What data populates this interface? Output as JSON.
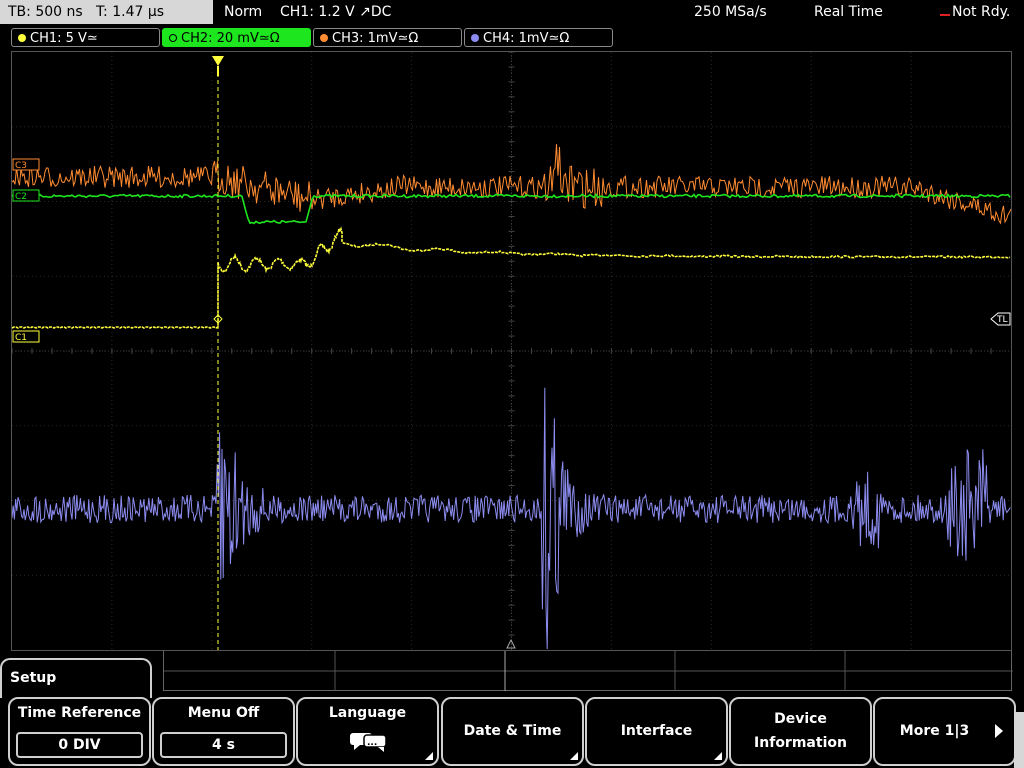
{
  "topbar": {
    "timebase": "TB: 500 ns",
    "trigger_time": "T: 1.47 µs",
    "trigger_mode": "Norm",
    "trigger_source": "CH1: 1.2 V ↗DC",
    "sample_rate": "250 MSa/s",
    "acq_mode": "Real Time",
    "status": "Not Rdy."
  },
  "channels": [
    {
      "label": "CH1: 5 V≃",
      "color": "#ffff3c"
    },
    {
      "label": "CH2: 20 mV≃Ω",
      "color": "#1ee61e"
    },
    {
      "label": "CH3: 1mV≃Ω",
      "color": "#ff8c32"
    },
    {
      "label": "CH4: 1mV≃Ω",
      "color": "#8c8cf0"
    }
  ],
  "markers": {
    "c3": "C3",
    "c2": "C2",
    "c1": "C1",
    "trigger_level": "TL"
  },
  "menu": {
    "title": "Setup",
    "time_reference": {
      "label": "Time Reference",
      "value": "0 DIV"
    },
    "menu_off": {
      "label": "Menu Off",
      "value": "4 s"
    },
    "language": {
      "label": "Language"
    },
    "date_time": {
      "label": "Date & Time"
    },
    "interface": {
      "label": "Interface"
    },
    "device_information": {
      "line1": "Device",
      "line2": "Information"
    },
    "more": {
      "label": "More 1|3"
    }
  }
}
